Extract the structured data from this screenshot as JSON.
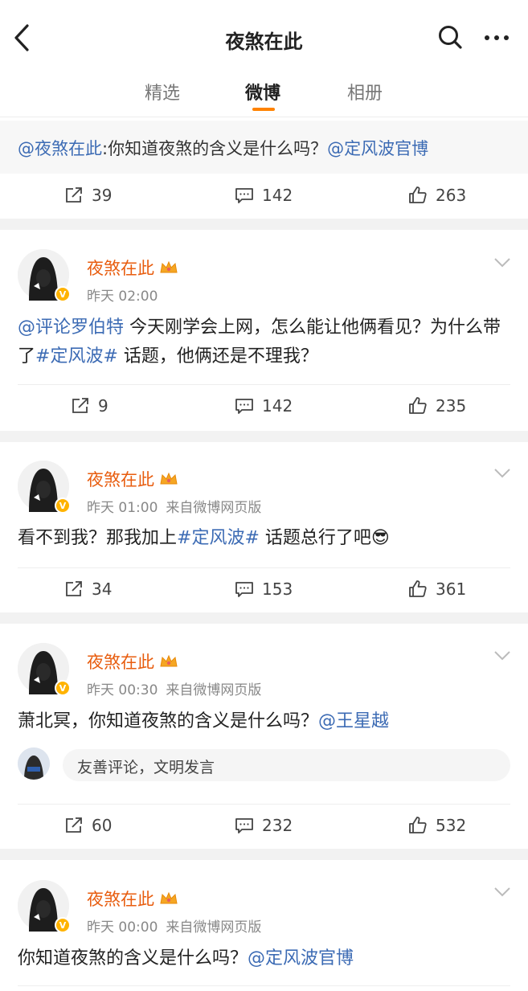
{
  "header": {
    "title": "夜煞在此",
    "back_icon": "back-arrow-icon",
    "search_icon": "search-icon",
    "more_icon": "more-dots-icon"
  },
  "tabs": [
    {
      "label": "精选"
    },
    {
      "label": "微博",
      "active": true
    },
    {
      "label": "相册"
    }
  ],
  "colors": {
    "accent": "#ff8200",
    "link": "#3c6bb4",
    "username": "#e85d0f"
  },
  "repost": {
    "mention": "@夜煞在此",
    "text": ":你知道夜煞的含义是什么吗？",
    "tag": "@定风波官博",
    "reposts": "39",
    "comments": "142",
    "likes": "263"
  },
  "posts": [
    {
      "username": "夜煞在此",
      "time": "昨天 02:00",
      "source": "",
      "text_parts": [
        "@评论罗伯特",
        " 今天刚学会上网，怎么能让他俩看见？为什么带了",
        "#定风波#",
        " 话题，他俩还是不理我？"
      ],
      "reposts": "9",
      "comments": "142",
      "likes": "235"
    },
    {
      "username": "夜煞在此",
      "time": "昨天 01:00",
      "source": "来自微博网页版",
      "text_parts": [
        "看不到我？那我加上",
        "#定风波#",
        " 话题总行了吧"
      ],
      "emoji": "😎",
      "reposts": "34",
      "comments": "153",
      "likes": "361"
    },
    {
      "username": "夜煞在此",
      "time": "昨天 00:30",
      "source": "来自微博网页版",
      "text_parts": [
        "萧北冥，你知道夜煞的含义是什么吗？",
        "@王星越"
      ],
      "comment_placeholder": "友善评论，文明发言",
      "reposts": "60",
      "comments": "232",
      "likes": "532"
    },
    {
      "username": "夜煞在此",
      "time": "昨天 00:00",
      "source": "来自微博网页版",
      "text_parts": [
        "你知道夜煞的含义是什么吗？",
        "@定风波官博"
      ]
    }
  ]
}
